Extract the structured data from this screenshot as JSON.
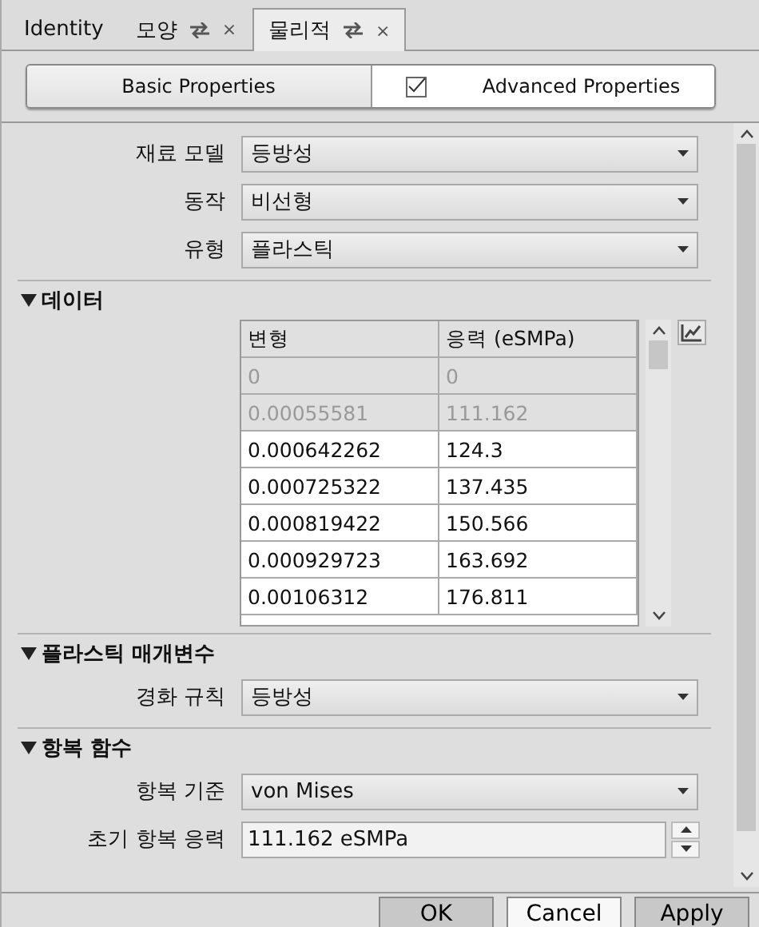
{
  "tabs": [
    {
      "label": "Identity",
      "selected": false
    },
    {
      "label": "모양",
      "selected": false,
      "close": "×"
    },
    {
      "label": "물리적",
      "selected": true,
      "close": "×"
    }
  ],
  "mode_toggle": [
    {
      "label": "Basic Properties",
      "selected": false
    },
    {
      "label": "Advanced Properties",
      "selected": true
    }
  ],
  "material_fields": [
    {
      "label": "재료 모델",
      "value": "등방성"
    },
    {
      "label": "동작",
      "value": "비선형"
    },
    {
      "label": "유형",
      "value": "플라스틱"
    }
  ],
  "sections": [
    {
      "title": "데이터",
      "expanded": true,
      "kind": "table",
      "columns": [
        "변형",
        "응력 (eSMPa)"
      ],
      "rows": [
        {
          "cells": [
            "0",
            "0"
          ],
          "disabled": true
        },
        {
          "cells": [
            "0.00055581",
            "111.162"
          ],
          "disabled": true
        },
        {
          "cells": [
            "0.000642262",
            "124.3"
          ],
          "disabled": false
        },
        {
          "cells": [
            "0.000725322",
            "137.435"
          ],
          "disabled": false
        },
        {
          "cells": [
            "0.000819422",
            "150.566"
          ],
          "disabled": false
        },
        {
          "cells": [
            "0.000929723",
            "163.692"
          ],
          "disabled": false
        },
        {
          "cells": [
            "0.00106312",
            "176.811"
          ],
          "disabled": false
        }
      ]
    },
    {
      "title": "플라스틱 매개변수",
      "expanded": true,
      "kind": "fields",
      "fields": [
        {
          "label": "경화 규칙",
          "value": "등방성",
          "kind": "select"
        }
      ]
    },
    {
      "title": "항복 함수",
      "expanded": true,
      "kind": "fields",
      "fields": [
        {
          "label": "항복 기준",
          "value": "von Mises",
          "kind": "select"
        },
        {
          "label": "초기 항복 응력",
          "value": "111.162 eSMPa",
          "kind": "spin"
        }
      ]
    }
  ],
  "buttons": [
    {
      "label": "OK",
      "selected": false
    },
    {
      "label": "Cancel",
      "selected": true
    },
    {
      "label": "Apply",
      "selected": false
    }
  ]
}
